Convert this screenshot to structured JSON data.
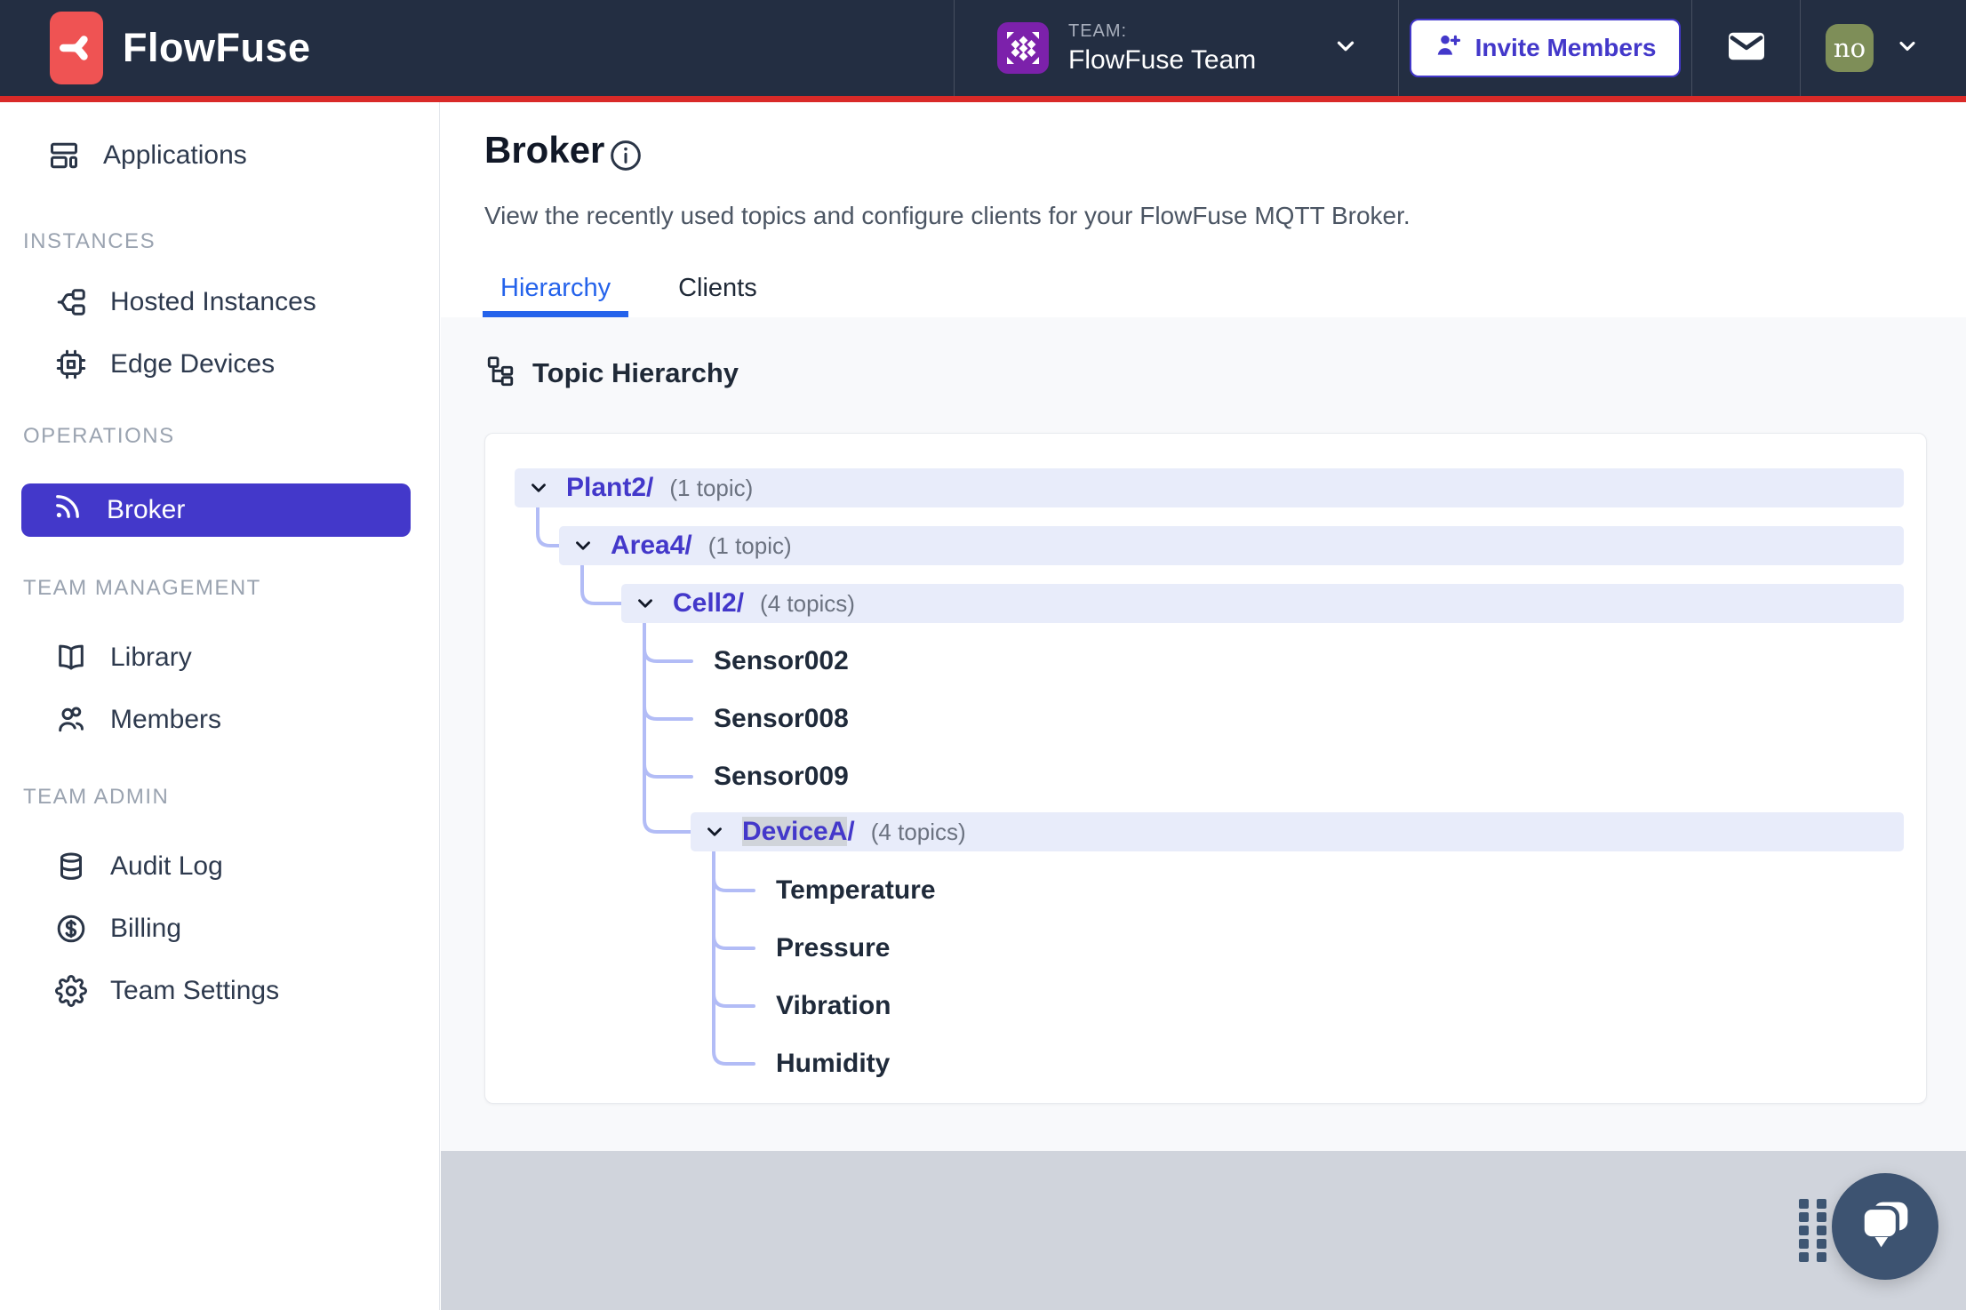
{
  "navbar": {
    "brand": "FlowFuse",
    "team_label": "TEAM:",
    "team_name": "FlowFuse Team",
    "invite_button": "Invite Members",
    "avatar_initials": "no"
  },
  "sidebar": {
    "top_item": {
      "label": "Applications"
    },
    "sections": [
      {
        "title": "INSTANCES",
        "items": [
          {
            "label": "Hosted Instances"
          },
          {
            "label": "Edge Devices"
          }
        ]
      },
      {
        "title": "OPERATIONS",
        "items": [
          {
            "label": "Broker",
            "active": true
          }
        ]
      },
      {
        "title": "TEAM MANAGEMENT",
        "items": [
          {
            "label": "Library"
          },
          {
            "label": "Members"
          }
        ]
      },
      {
        "title": "TEAM ADMIN",
        "items": [
          {
            "label": "Audit Log"
          },
          {
            "label": "Billing"
          },
          {
            "label": "Team Settings"
          }
        ]
      }
    ]
  },
  "page": {
    "title": "Broker",
    "subtitle": "View the recently used topics and configure clients for your FlowFuse MQTT Broker."
  },
  "tabs": [
    {
      "label": "Hierarchy",
      "active": true
    },
    {
      "label": "Clients",
      "active": false
    }
  ],
  "topic_hierarchy": {
    "heading": "Topic Hierarchy",
    "nodes": [
      {
        "type": "branch",
        "label": "Plant2/",
        "count": "(1 topic)"
      },
      {
        "type": "branch",
        "label": "Area4/",
        "count": "(1 topic)"
      },
      {
        "type": "branch",
        "label": "Cell2/",
        "count": "(4 topics)"
      },
      {
        "type": "leaf",
        "label": "Sensor002"
      },
      {
        "type": "leaf",
        "label": "Sensor008"
      },
      {
        "type": "leaf",
        "label": "Sensor009"
      },
      {
        "type": "branch",
        "label_selected": "DeviceA",
        "label_rest": "/",
        "count": "(4 topics)"
      },
      {
        "type": "leaf",
        "label": "Temperature"
      },
      {
        "type": "leaf",
        "label": "Pressure"
      },
      {
        "type": "leaf",
        "label": "Vibration"
      },
      {
        "type": "leaf",
        "label": "Humidity"
      }
    ]
  },
  "colors": {
    "navbar_bg": "#232e42",
    "red_accent_line": "#d92a28",
    "brand_red": "#ef5353",
    "accent_indigo": "#4338ca",
    "active_tab_blue": "#2563eb",
    "tree_row_bg": "#e8ecfa",
    "tree_connector": "#b2bcf6",
    "content_bg": "#f8f9fb",
    "bottom_band_bg": "#d0d4dc",
    "chat_button_bg": "#3d5371",
    "user_avatar_bg": "#7e8e58",
    "team_avatar_bg": "#7c21ab"
  }
}
